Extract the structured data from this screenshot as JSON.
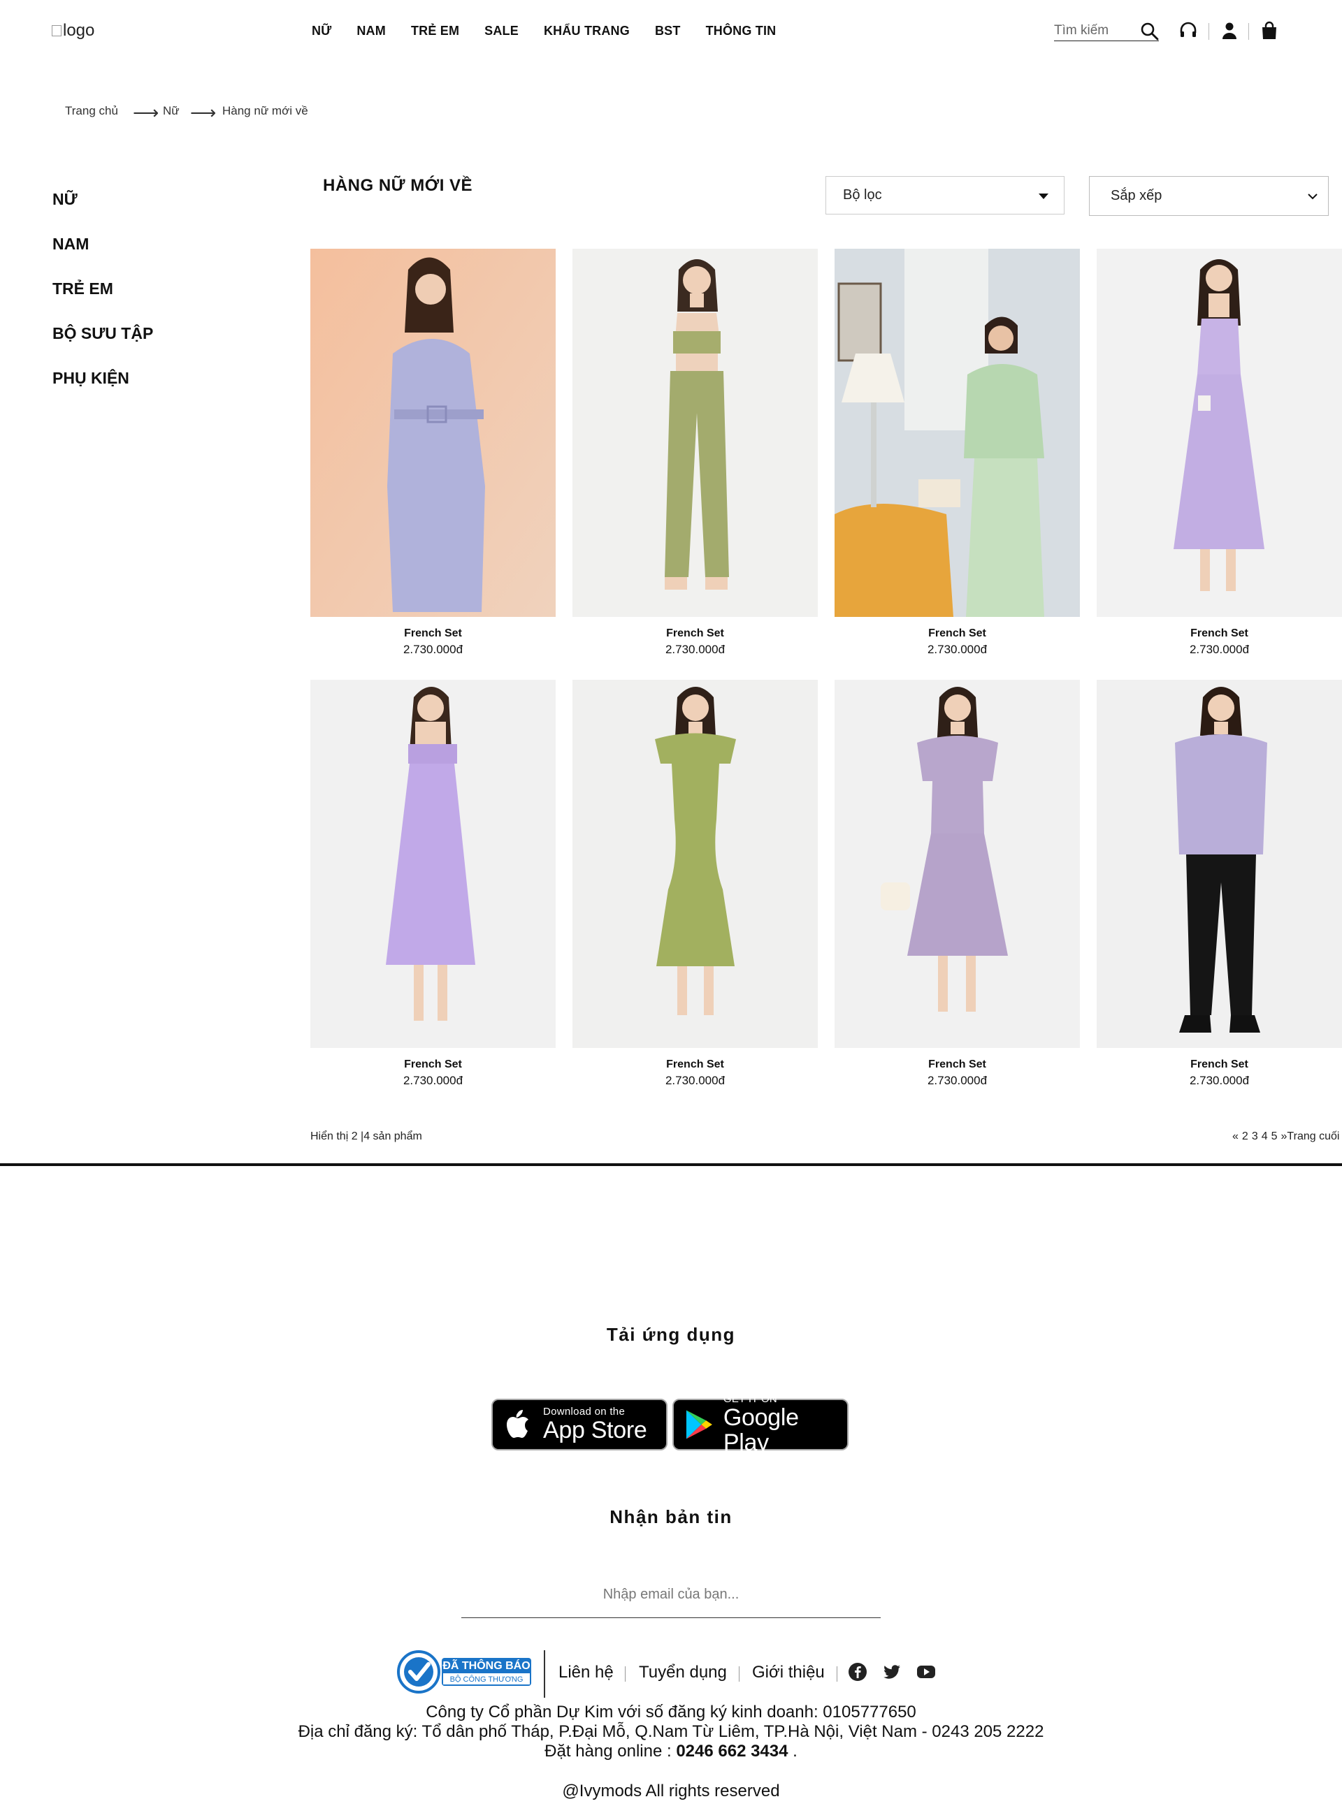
{
  "header": {
    "logo_alt": "logo",
    "nav": [
      "NỮ",
      "NAM",
      "TRẺ EM",
      "SALE",
      "KHẨU TRANG",
      "BST",
      "THÔNG TIN"
    ],
    "search_placeholder": "Tìm kiếm"
  },
  "breadcrumb": {
    "items": [
      "Trang chủ",
      "Nữ",
      "Hàng nữ mới về"
    ],
    "separator": "⟶"
  },
  "sidebar": {
    "categories": [
      "NỮ",
      "NAM",
      "TRẺ EM",
      "BỘ SƯU TẬP",
      "PHỤ KIỆN"
    ]
  },
  "listing": {
    "title": "HÀNG NỮ MỚI VỀ",
    "filter_label": "Bộ lọc",
    "sort_label": "Sắp xếp",
    "products": [
      {
        "name": "French Set",
        "price": "2.730.000đ"
      },
      {
        "name": "French Set",
        "price": "2.730.000đ"
      },
      {
        "name": "French Set",
        "price": "2.730.000đ"
      },
      {
        "name": "French Set",
        "price": "2.730.000đ"
      },
      {
        "name": "French Set",
        "price": "2.730.000đ"
      },
      {
        "name": "French Set",
        "price": "2.730.000đ"
      },
      {
        "name": "French Set",
        "price": "2.730.000đ"
      },
      {
        "name": "French Set",
        "price": "2.730.000đ"
      }
    ],
    "results_text": "Hiển thị 2 |4 sản phẩm",
    "pagination": [
      "«",
      "2",
      "3",
      "4",
      "5",
      "»Trang cuối"
    ]
  },
  "footer": {
    "app_title": "Tải ứng dụng",
    "appstore": {
      "small": "Download on the",
      "big": "App Store"
    },
    "googleplay": {
      "small": "GET IT ON",
      "big": "Google Play"
    },
    "newsletter_title": "Nhận bản tin",
    "email_placeholder": "Nhập email của bạn...",
    "badge": {
      "line1": "ĐÃ THÔNG BÁO",
      "line2": "BỘ CÔNG THƯƠNG"
    },
    "links": [
      "Liên hệ",
      "Tuyển dụng",
      "Giới thiệu"
    ],
    "company": "Công ty Cổ phần Dự Kim với số đăng ký kinh doanh: 0105777650",
    "address": "Địa chỉ đăng ký: Tổ dân phố Tháp, P.Đại Mỗ, Q.Nam Từ Liêm, TP.Hà Nội, Việt Nam - 0243 205 2222",
    "order_prefix": "Đặt hàng online : ",
    "order_phone": "0246 662 3434",
    "order_suffix": " .",
    "copyright": "@Ivymods All rights reserved"
  },
  "colors": {
    "text": "#111111",
    "badge_blue": "#1a74c8",
    "lavender": "#b9a9d9",
    "sage": "#a8b97a"
  }
}
